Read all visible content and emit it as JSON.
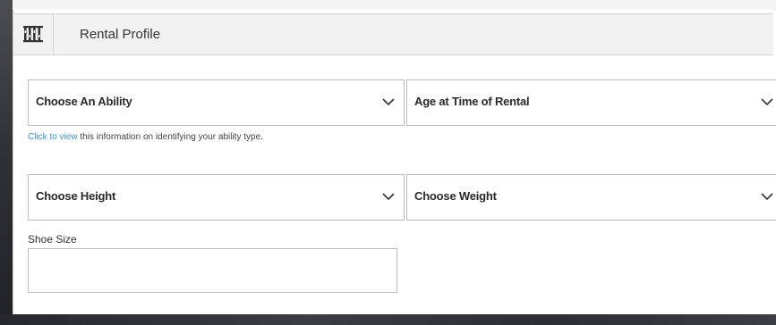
{
  "header": {
    "title": "Rental Profile",
    "icon": "ski-rack-icon"
  },
  "fields": {
    "ability": {
      "label": "Choose An Ability"
    },
    "age": {
      "label": "Age at Time of Rental"
    },
    "height": {
      "label": "Choose Height"
    },
    "weight": {
      "label": "Choose Weight"
    },
    "shoe_size": {
      "label": "Shoe Size",
      "value": "",
      "placeholder": ""
    }
  },
  "help": {
    "link_text": "Click to view",
    "text": " this information on identifying your ability type."
  },
  "colors": {
    "link": "#3a8fd0",
    "header_bg": "#f2f2f2",
    "border": "#bdbdbd"
  }
}
